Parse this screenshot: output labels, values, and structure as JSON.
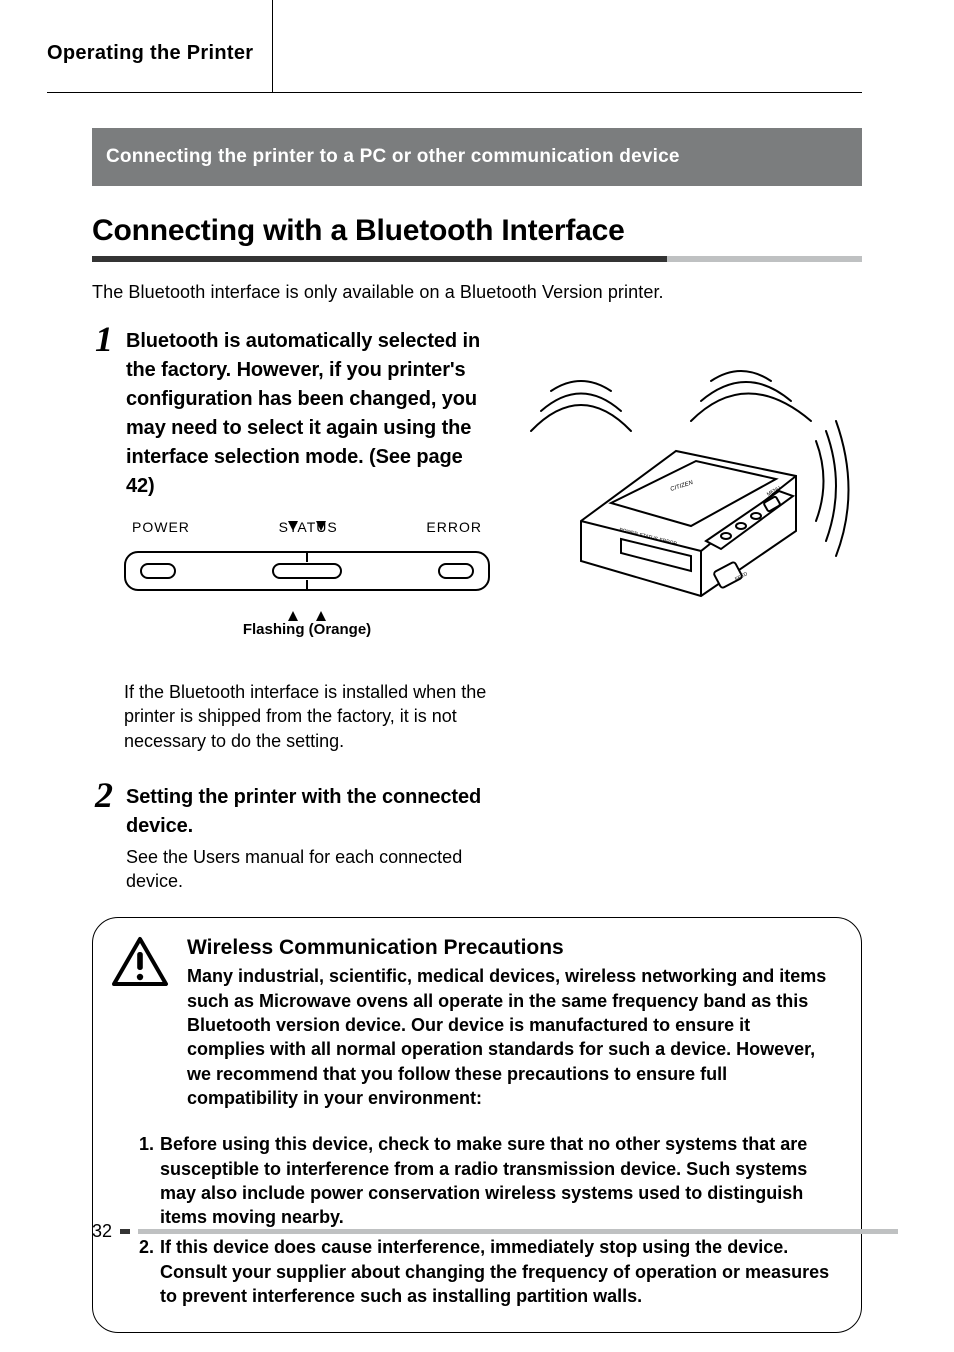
{
  "header": {
    "section": "Operating the Printer"
  },
  "greyBar": "Connecting the printer to a PC or other communication device",
  "title": "Connecting with a Bluetooth Interface",
  "intro": "The Bluetooth interface is only available on a Bluetooth Version printer.",
  "step1": {
    "num": "1",
    "heading": "Bluetooth is automatically selected in the factory. However, if you printer's configuration has been changed, you may need to select it again using the interface selection mode. (See page 42)",
    "indicator": {
      "power": "POWER",
      "status": "STATUS",
      "error": "ERROR",
      "flashing": "Flashing (Orange)"
    },
    "note": "If the Bluetooth interface is installed when the printer is shipped from the factory, it is not necessary to do the setting."
  },
  "step2": {
    "num": "2",
    "heading": "Setting the printer with the connected device.",
    "note": "See the Users manual for each connected device."
  },
  "callout": {
    "title": "Wireless Communication Precautions",
    "body": "Many industrial, scientific, medical devices, wireless networking and items such as Microwave ovens all operate in the same frequency band as this Bluetooth version device. Our device is manufactured to ensure it complies with all normal operation standards for such a device. However, we recommend that you follow these precautions to ensure full compatibility in your environment:",
    "items": [
      {
        "n": "1.",
        "t": "Before using this device, check to make sure that no other systems that are susceptible to interference from a radio transmission device. Such systems may also include power conservation wireless systems used to distinguish items moving nearby."
      },
      {
        "n": "2.",
        "t": "If this device does cause interference, immediately stop using the device. Consult your supplier about changing the frequency of operation or measures to prevent interference such as installing partition walls."
      }
    ]
  },
  "page": "32",
  "figure": {
    "brand": "CITIZEN",
    "labels": {
      "power": "POWER",
      "status": "STATUS",
      "error": "ERROR",
      "menu": "MENU",
      "feed": "FEED"
    }
  }
}
